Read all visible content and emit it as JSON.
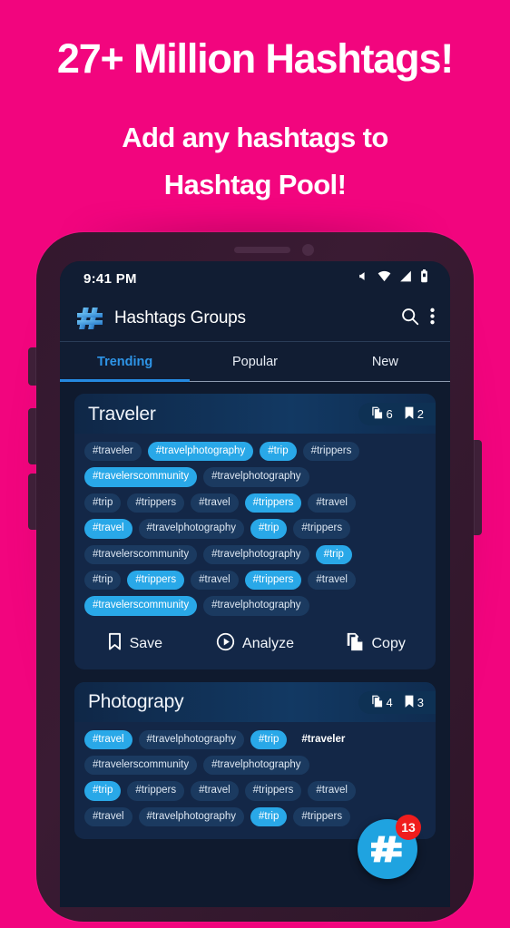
{
  "promo": {
    "title": "27+ Million Hashtags!",
    "sub1": "Add any hashtags to",
    "sub2": "Hashtag Pool!",
    "bg_color": "#F2057E",
    "text_color": "#FFFFFF"
  },
  "statusbar": {
    "time": "9:41 PM",
    "icons": [
      "volume-mute-icon",
      "wifi-icon",
      "signal-icon",
      "battery-icon"
    ]
  },
  "appbar": {
    "logo": "hash-logo-icon",
    "title": "Hashtags Groups",
    "search_icon": "search-icon",
    "overflow_icon": "more-vertical-icon"
  },
  "tabs": {
    "items": [
      {
        "label": "Trending",
        "active": true
      },
      {
        "label": "Popular",
        "active": false
      },
      {
        "label": "New",
        "active": false
      }
    ],
    "active_color": "#2e95e8",
    "indicator_color": "#2589e0"
  },
  "cards": [
    {
      "title": "Traveler",
      "badges": [
        {
          "icon": "copy-icon",
          "count": "6"
        },
        {
          "icon": "bookmark-icon",
          "count": "2"
        }
      ],
      "chip_rows": [
        [
          {
            "text": "#traveler",
            "style": "dim"
          },
          {
            "text": "#travelphotography",
            "style": "bright"
          },
          {
            "text": "#trip",
            "style": "bright"
          },
          {
            "text": "#trippers",
            "style": "dim"
          }
        ],
        [
          {
            "text": "#travelerscommunity",
            "style": "bright"
          },
          {
            "text": "#travelphotography",
            "style": "dim"
          }
        ],
        [
          {
            "text": "#trip",
            "style": "dim"
          },
          {
            "text": "#trippers",
            "style": "dim"
          },
          {
            "text": "#travel",
            "style": "dim"
          },
          {
            "text": "#trippers",
            "style": "bright"
          },
          {
            "text": "#travel",
            "style": "dim"
          }
        ],
        [
          {
            "text": "#travel",
            "style": "bright"
          },
          {
            "text": "#travelphotography",
            "style": "dim"
          },
          {
            "text": "#trip",
            "style": "bright"
          },
          {
            "text": "#trippers",
            "style": "dim"
          }
        ],
        [
          {
            "text": "#travelerscommunity",
            "style": "dim"
          },
          {
            "text": "#travelphotography",
            "style": "dim"
          },
          {
            "text": "#trip",
            "style": "bright"
          }
        ],
        [
          {
            "text": "#trip",
            "style": "dim"
          },
          {
            "text": "#trippers",
            "style": "bright"
          },
          {
            "text": "#travel",
            "style": "dim"
          },
          {
            "text": "#trippers",
            "style": "bright"
          },
          {
            "text": "#travel",
            "style": "dim"
          }
        ],
        [
          {
            "text": "#travelerscommunity",
            "style": "bright"
          },
          {
            "text": "#travelphotography",
            "style": "dim"
          }
        ]
      ],
      "actions": [
        {
          "label": "Save",
          "icon": "bookmark-icon"
        },
        {
          "label": "Analyze",
          "icon": "play-circle-icon"
        },
        {
          "label": "Copy",
          "icon": "copy-icon"
        }
      ]
    },
    {
      "title": "Photograpy",
      "badges": [
        {
          "icon": "copy-icon",
          "count": "4"
        },
        {
          "icon": "bookmark-icon",
          "count": "3"
        }
      ],
      "chip_rows": [
        [
          {
            "text": "#travel",
            "style": "bright"
          },
          {
            "text": "#travelphotography",
            "style": "dim"
          },
          {
            "text": "#trip",
            "style": "bright"
          },
          {
            "text": "#traveler",
            "style": "bold"
          }
        ],
        [
          {
            "text": "#travelerscommunity",
            "style": "dim"
          },
          {
            "text": "#travelphotography",
            "style": "dim"
          }
        ],
        [
          {
            "text": "#trip",
            "style": "bright"
          },
          {
            "text": "#trippers",
            "style": "dim"
          },
          {
            "text": "#travel",
            "style": "dim"
          },
          {
            "text": "#trippers",
            "style": "dim"
          },
          {
            "text": "#travel",
            "style": "dim"
          }
        ],
        [
          {
            "text": "#travel",
            "style": "dim"
          },
          {
            "text": "#travelphotography",
            "style": "dim"
          },
          {
            "text": "#trip",
            "style": "bright"
          },
          {
            "text": "#trippers",
            "style": "dim"
          }
        ]
      ],
      "actions": []
    }
  ],
  "fab": {
    "icon": "hash-icon",
    "badge_count": "13",
    "color": "#1fa3e0",
    "badge_color": "#f01d1d"
  }
}
